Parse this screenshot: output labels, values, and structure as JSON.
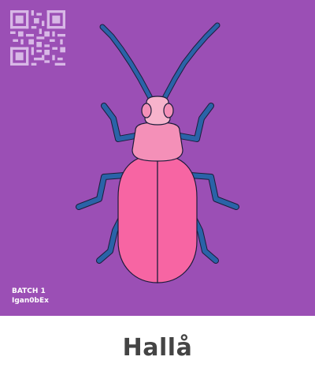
{
  "card": {
    "batch_label": "BATCH 1",
    "code": "Igan0bEx",
    "name": "Hallå"
  },
  "colors": {
    "background": "#9b4fb5",
    "elytra": "#f765a3",
    "thorax": "#f490b8",
    "head": "#f7b3cc",
    "legs": "#2a63a8",
    "outline": "#1c1c3a",
    "qr": "#d8b8e6",
    "footer_text": "#444444"
  },
  "icons": {
    "qr": "qr-code-icon",
    "beetle": "beetle-icon"
  }
}
